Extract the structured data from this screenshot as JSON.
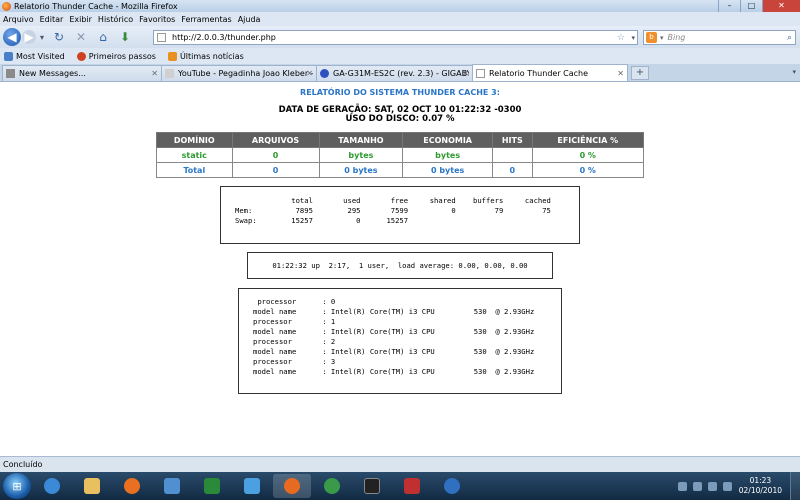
{
  "window": {
    "title": "Relatorio Thunder Cache - Mozilla Firefox",
    "controls": {
      "minimize": "–",
      "maximize": "□",
      "close": "✕"
    }
  },
  "menu": [
    "Arquivo",
    "Editar",
    "Exibir",
    "Histórico",
    "Favoritos",
    "Ferramentas",
    "Ajuda"
  ],
  "navbar": {
    "url": "http://2.0.0.3/thunder.php",
    "search_placeholder": "Bing",
    "icons": [
      "back-icon",
      "forward-icon",
      "reload-icon",
      "stop-icon",
      "home-icon",
      "download-icon"
    ]
  },
  "bookmarks": [
    {
      "label": "Most Visited",
      "color": "#4a7fc8"
    },
    {
      "label": "Primeiros passos",
      "color": "#d04020"
    },
    {
      "label": "Últimas notícias",
      "color": "#e89020"
    }
  ],
  "tabs": [
    {
      "label": "New Messages...",
      "color": "#8a8a8a",
      "active": false
    },
    {
      "label": "YouTube - Pegadinha Joao Kleber -...",
      "color": "#d0d0d0",
      "active": false
    },
    {
      "label": "GA-G31M-ES2C (rev. 2.3) - GIGABYTE ...",
      "color": "#3050c0",
      "active": false
    },
    {
      "label": "Relatorio Thunder Cache",
      "color": "#ffffff",
      "active": true
    }
  ],
  "report": {
    "title": "RELATÓRIO DO SISTEMA THUNDER CACHE 3:",
    "generated": "DATA DE GERAÇÃO: SAT, 02 OCT 10 01:22:32 -0300",
    "disk_usage": "USO DO DISCO: 0.07 %",
    "table": {
      "headers": [
        "DOMÍNIO",
        "ARQUIVOS",
        "TAMANHO",
        "ECONOMIA",
        "HITS",
        "EFICIÊNCIA %"
      ],
      "rows": [
        [
          "static",
          "0",
          "bytes",
          "bytes",
          "",
          "0 %"
        ],
        [
          "Total",
          "0",
          "0 bytes",
          "0 bytes",
          "0",
          "0 %"
        ]
      ]
    },
    "memory_output": "             total       used       free     shared    buffers     cached\nMem:          7895        295       7599          0         79         75\nSwap:        15257          0      15257",
    "uptime_output": " 01:22:32 up  2:17,  1 user,  load average: 0.00, 0.00, 0.00",
    "cpu_output": " processor      : 0\nmodel name      : Intel(R) Core(TM) i3 CPU         530  @ 2.93GHz\nprocessor       : 1\nmodel name      : Intel(R) Core(TM) i3 CPU         530  @ 2.93GHz\nprocessor       : 2\nmodel name      : Intel(R) Core(TM) i3 CPU         530  @ 2.93GHz\nprocessor       : 3\nmodel name      : Intel(R) Core(TM) i3 CPU         530  @ 2.93GHz"
  },
  "status": "Concluído",
  "taskbar": {
    "apps": [
      {
        "name": "ie-icon",
        "color": "#3a8ad8"
      },
      {
        "name": "explorer-icon",
        "color": "#e8c060"
      },
      {
        "name": "media-player-icon",
        "color": "#e87020"
      },
      {
        "name": "windows-media-icon",
        "color": "#5090d0"
      },
      {
        "name": "excel-icon",
        "color": "#2a8a3a"
      },
      {
        "name": "live-messenger-icon",
        "color": "#4aa0e0"
      },
      {
        "name": "firefox-icon",
        "color": "#e86a20"
      },
      {
        "name": "chrome-icon",
        "color": "#3a9a4a"
      },
      {
        "name": "cmd-icon",
        "color": "#222222"
      },
      {
        "name": "gigabyte-icon",
        "color": "#c03030"
      },
      {
        "name": "download-arrow-icon",
        "color": "#3070c0"
      }
    ],
    "time": "01:23",
    "date": "02/10/2010"
  }
}
